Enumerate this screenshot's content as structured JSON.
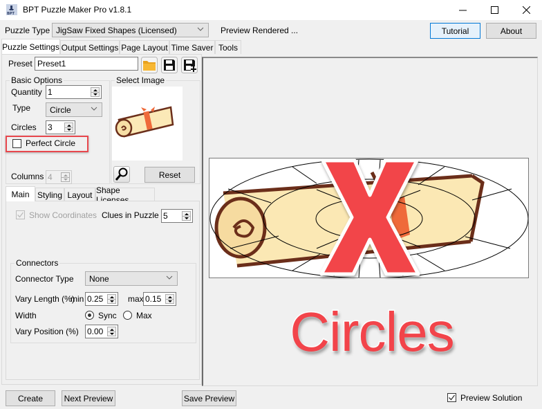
{
  "window": {
    "title": "BPT Puzzle Maker Pro v1.8.1",
    "icon": "bpt-app-icon",
    "controls": [
      "minimize-icon",
      "maximize-icon",
      "close-icon"
    ]
  },
  "toolbar": {
    "puzzle_type_label": "Puzzle Type",
    "puzzle_type_value": "JigSaw Fixed Shapes (Licensed)",
    "status": "Preview Rendered ...",
    "tutorial_label": "Tutorial",
    "about_label": "About"
  },
  "main_tabs": [
    {
      "label": "Puzzle Settings",
      "active": true
    },
    {
      "label": "Output Settings",
      "active": false
    },
    {
      "label": "Page Layout",
      "active": false
    },
    {
      "label": "Time Saver",
      "active": false
    },
    {
      "label": "Tools",
      "active": false
    }
  ],
  "preset": {
    "label": "Preset",
    "value": "Preset1",
    "icons": [
      "folder-open-icon",
      "save-icon",
      "save-as-icon"
    ]
  },
  "basic_options": {
    "title": "Basic Options",
    "quantity_label": "Quantity",
    "quantity_value": "1",
    "type_label": "Type",
    "type_value": "Circle",
    "circles_label": "Circles",
    "circles_value": "3",
    "perfect_circle_label": "Perfect Circle",
    "perfect_circle_checked": false,
    "columns_label": "Columns",
    "columns_value": "4"
  },
  "select_image": {
    "title": "Select Image",
    "thumbnail": "scroll-image",
    "zoom_icon": "magnifier-icon",
    "reset_label": "Reset"
  },
  "sub_tabs": [
    {
      "label": "Main",
      "active": true
    },
    {
      "label": "Styling",
      "active": false
    },
    {
      "label": "Layout",
      "active": false
    },
    {
      "label": "Shape Licenses",
      "active": false
    }
  ],
  "main_tab": {
    "show_coordinates_label": "Show Coordinates",
    "show_coordinates_checked": true,
    "show_coordinates_enabled": false,
    "clues_label": "Clues in Puzzle",
    "clues_value": "5"
  },
  "connectors": {
    "title": "Connectors",
    "type_label": "Connector Type",
    "type_value": "None",
    "vary_length_label": "Vary Length (%)",
    "min_label": "min",
    "min_value": "0.25",
    "max_label": "max",
    "max_value": "0.15",
    "width_label": "Width",
    "width_options": [
      {
        "label": "Sync",
        "selected": true
      },
      {
        "label": "Max",
        "selected": false
      }
    ],
    "vary_position_label": "Vary Position (%)",
    "vary_position_value": "0.00"
  },
  "preview": {
    "overlay_mark": "X",
    "overlay_caption": "Circles",
    "overlay_color": "#f2444a",
    "rings": 3
  },
  "footer": {
    "create_label": "Create",
    "next_preview_label": "Next Preview",
    "save_preview_label": "Save Preview",
    "preview_solution_label": "Preview Solution",
    "preview_solution_checked": true
  },
  "annotation": {
    "highlight_color": "#e8474d",
    "highlight_target": "perfect-circle-checkbox"
  }
}
